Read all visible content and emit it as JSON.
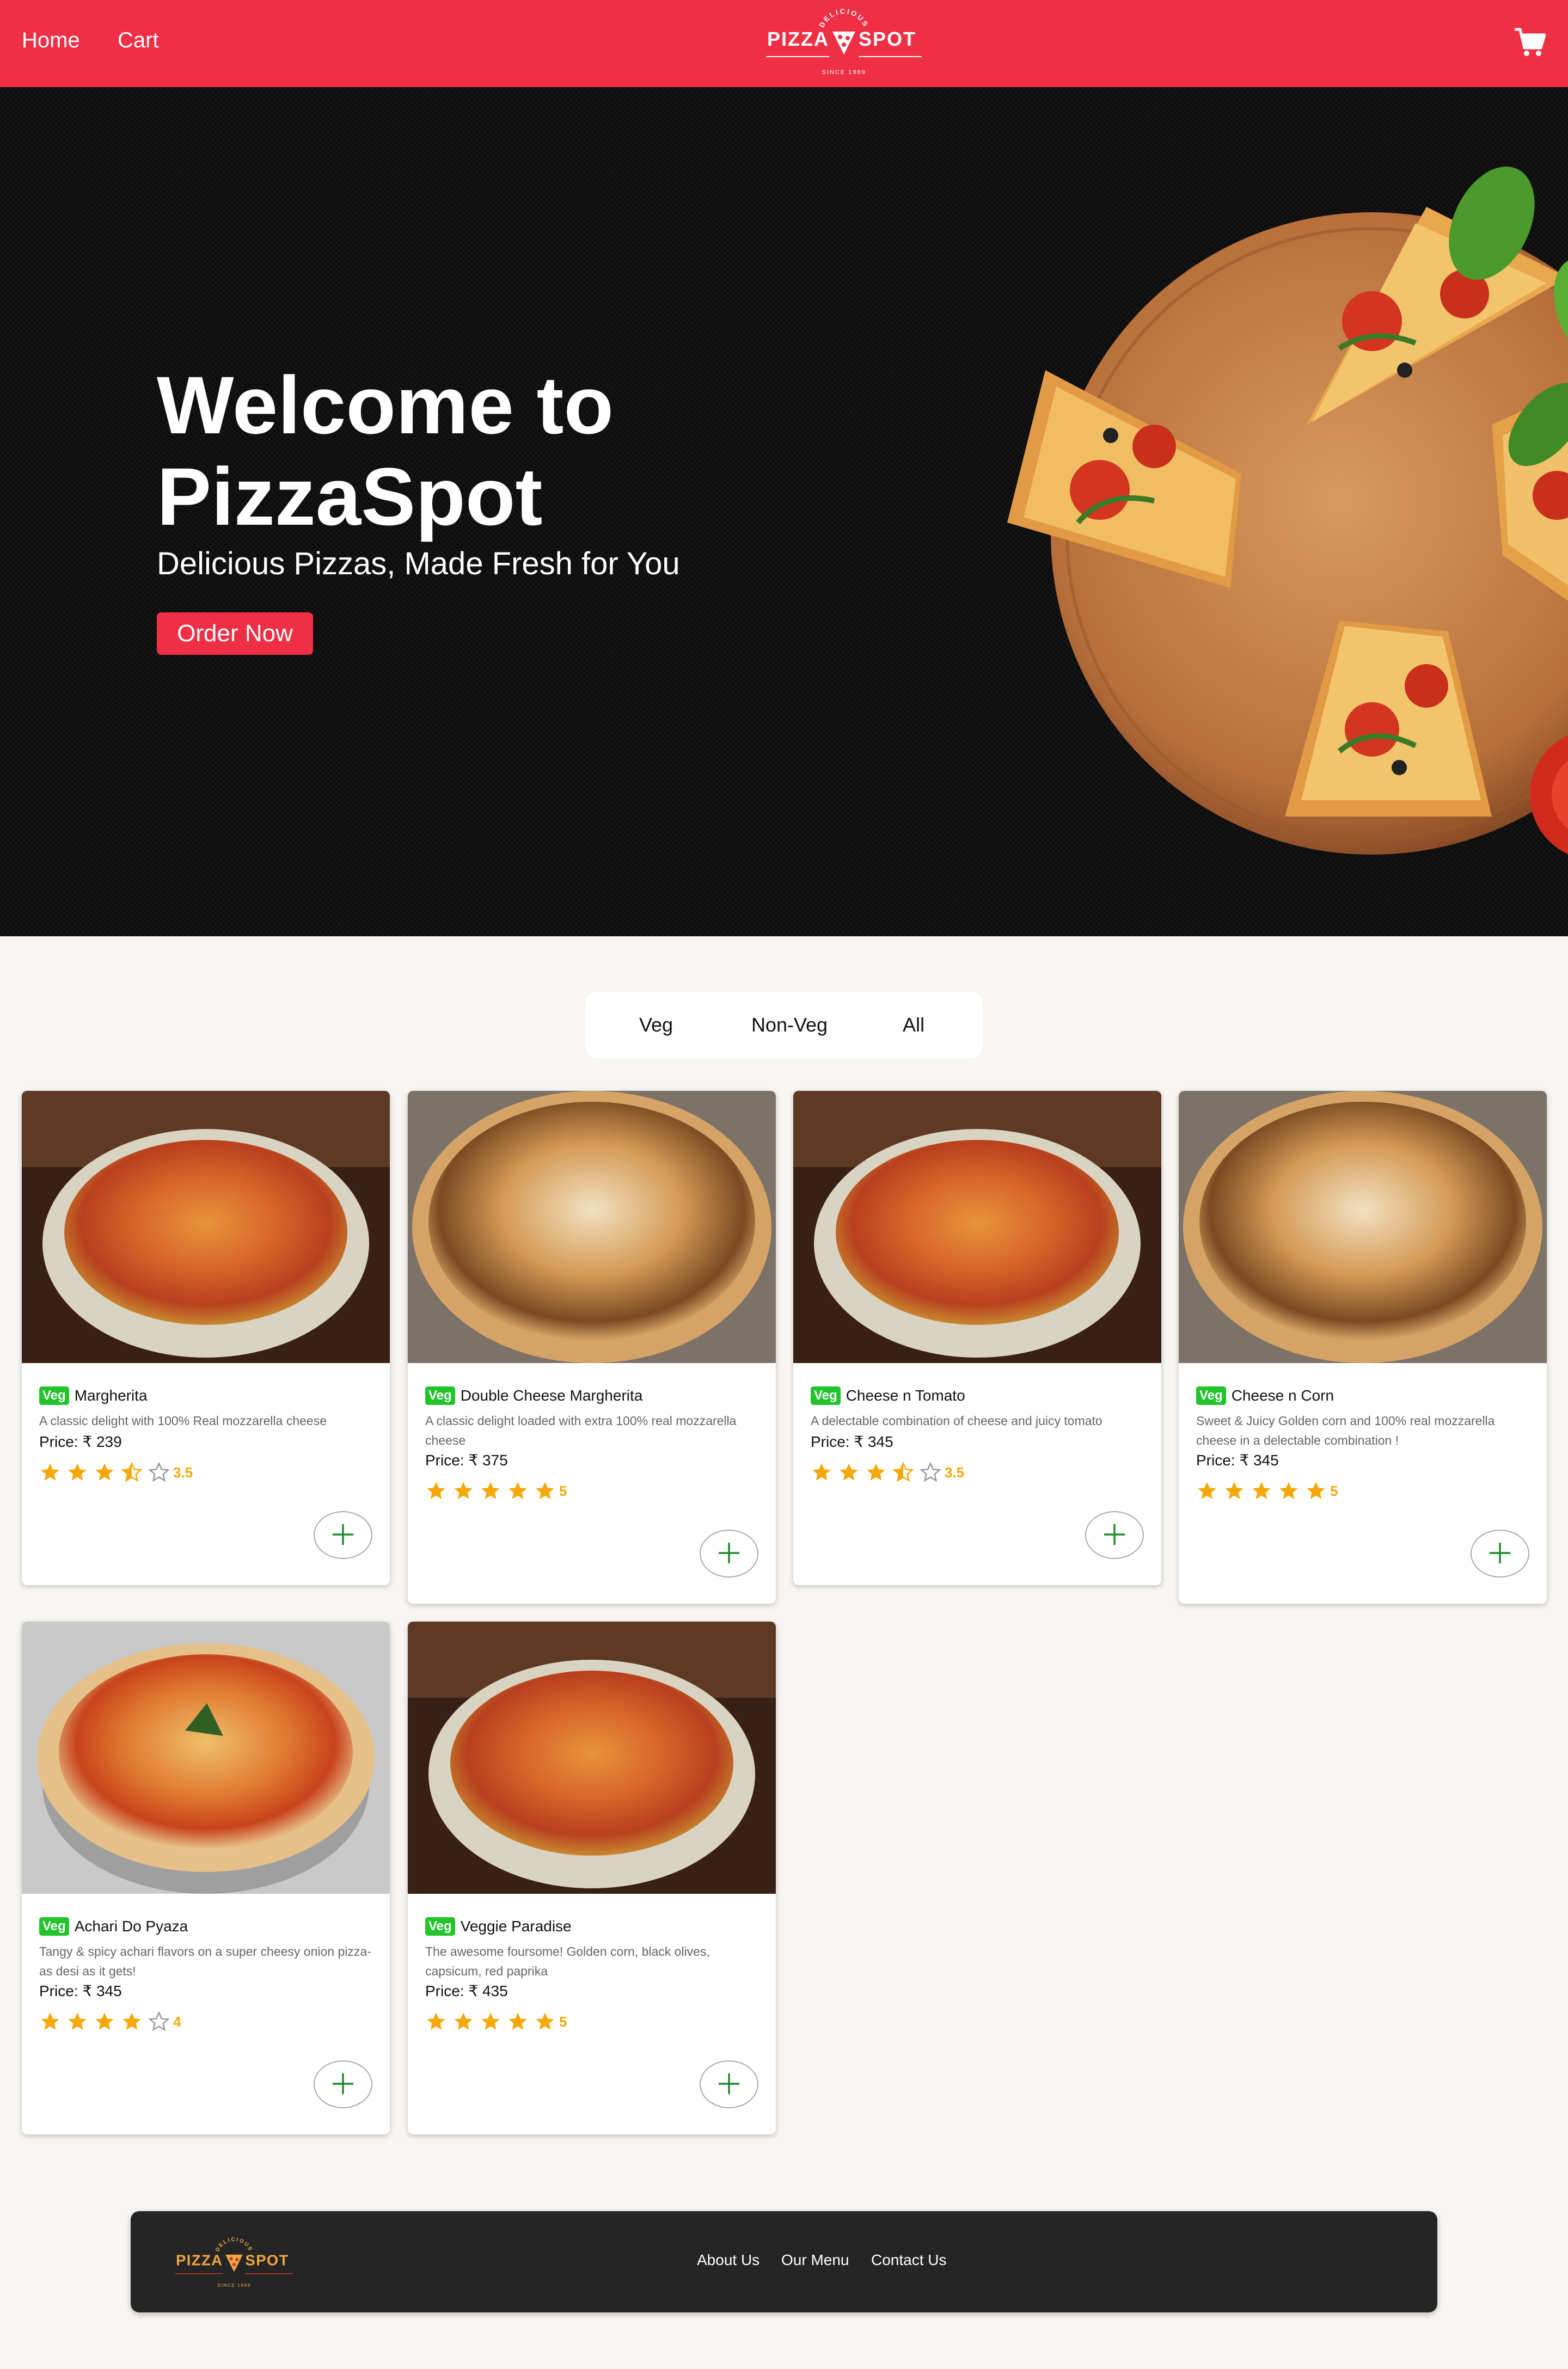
{
  "nav": {
    "home": "Home",
    "cart": "Cart",
    "logo": {
      "top": "DELICIOUS",
      "left": "PIZZA",
      "right": "SPOT",
      "bottom": "SINCE 1989"
    }
  },
  "hero": {
    "title": "Welcome to PizzaSpot",
    "subtitle": "Delicious Pizzas, Made Fresh for You",
    "cta": "Order Now"
  },
  "filters": [
    "Veg",
    "Non-Veg",
    "All"
  ],
  "products": [
    {
      "badge": "Veg",
      "name": "Margherita",
      "description": "A classic delight with 100% Real mozzarella cheese",
      "price": "Price: ₹ 239",
      "rating": 3.5,
      "rating_label": "3.5"
    },
    {
      "badge": "Veg",
      "name": "Double Cheese Margherita",
      "description": "A classic delight loaded with extra 100% real mozzarella cheese",
      "price": "Price: ₹ 375",
      "rating": 5,
      "rating_label": "5"
    },
    {
      "badge": "Veg",
      "name": "Cheese n Tomato",
      "description": "A delectable combination of cheese and juicy tomato",
      "price": "Price: ₹ 345",
      "rating": 3.5,
      "rating_label": "3.5"
    },
    {
      "badge": "Veg",
      "name": "Cheese n Corn",
      "description": "Sweet & Juicy Golden corn and 100% real mozzarella cheese in a delectable combination !",
      "price": "Price: ₹ 345",
      "rating": 5,
      "rating_label": "5"
    },
    {
      "badge": "Veg",
      "name": "Achari Do Pyaza",
      "description": "Tangy & spicy achari flavors on a super cheesy onion pizza- as desi as it gets!",
      "price": "Price: ₹ 345",
      "rating": 4,
      "rating_label": "4"
    },
    {
      "badge": "Veg",
      "name": "Veggie Paradise",
      "description": "The awesome foursome! Golden corn, black olives, capsicum, red paprika",
      "price": "Price: ₹ 435",
      "rating": 5,
      "rating_label": "5"
    }
  ],
  "footer": {
    "links": [
      "About Us",
      "Our Menu",
      "Contact Us"
    ]
  },
  "colors": {
    "brand_red": "#ef2f45",
    "veg_green": "#22c32b",
    "star": "#f6a808",
    "add_plus": "#1b8a2a",
    "footer_bg": "#252525"
  },
  "icons": {
    "cart": "cart-icon",
    "add": "plus-icon",
    "star": "star-icon"
  }
}
